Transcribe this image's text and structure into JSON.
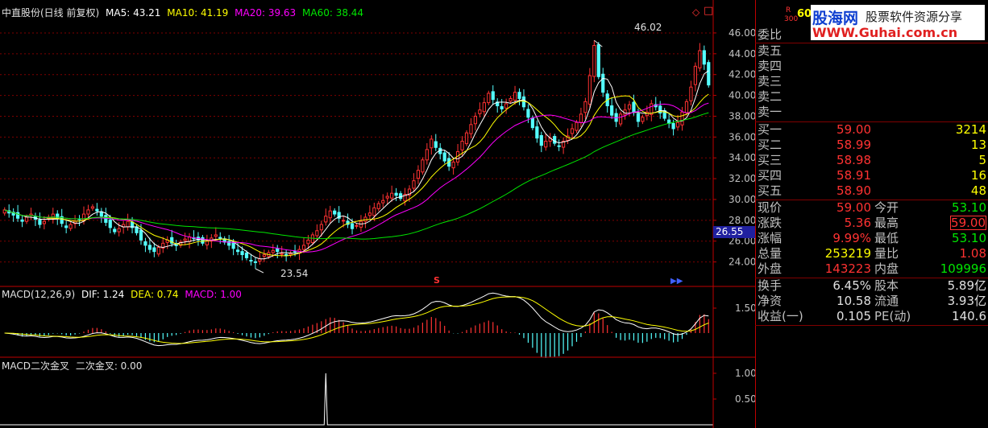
{
  "main_header": {
    "title": "中直股份(日线 前复权)",
    "ma5": "MA5: 43.21",
    "ma10": "MA10: 41.19",
    "ma20": "MA20: 39.63",
    "ma60": "MA60: 38.44"
  },
  "annotations": {
    "high_label": "46.02",
    "low_label": "23.54",
    "price_tag": "26.55",
    "marker_s": "S"
  },
  "macd_header": {
    "title": "MACD(12,26,9)",
    "dif": "DIF: 1.24",
    "dea": "DEA: 0.74",
    "macd": "MACD: 1.00"
  },
  "cross_header": {
    "title": "MACD二次金叉",
    "value": "二次金叉: 0.00"
  },
  "watermark": {
    "site_cn": "股海网",
    "slogan": "股票软件资源分享",
    "url": "WWW.Guhai.com.cn",
    "mini_r": "R",
    "mini_num": "300",
    "mini_code": "60"
  },
  "colors": {
    "up": "#ff3232",
    "down": "#54ffff",
    "ma5": "#ffffff",
    "ma10": "#ffff00",
    "ma20": "#ff00ff",
    "ma60": "#00e600",
    "grid": "#800000",
    "axis": "#c00000"
  },
  "order_book": {
    "ratio_label": "委比",
    "sells": [
      {
        "label": "卖五"
      },
      {
        "label": "卖四"
      },
      {
        "label": "卖三"
      },
      {
        "label": "卖二"
      },
      {
        "label": "卖一"
      }
    ],
    "buys": [
      {
        "label": "买一",
        "price": "59.00",
        "volume": "3214"
      },
      {
        "label": "买二",
        "price": "58.99",
        "volume": "13"
      },
      {
        "label": "买三",
        "price": "58.98",
        "volume": "5"
      },
      {
        "label": "买四",
        "price": "58.91",
        "volume": "16"
      },
      {
        "label": "买五",
        "price": "58.90",
        "volume": "48"
      }
    ]
  },
  "quote": {
    "rows": [
      {
        "l1": "现价",
        "v1": "59.00",
        "c1": "#ff3232",
        "l2": "今开",
        "v2": "53.10",
        "c2": "#00e600"
      },
      {
        "l1": "涨跌",
        "v1": "5.36",
        "c1": "#ff3232",
        "l2": "最高",
        "v2": "59.00",
        "c2": "#ff3232"
      },
      {
        "l1": "涨幅",
        "v1": "9.99%",
        "c1": "#ff3232",
        "l2": "最低",
        "v2": "53.10",
        "c2": "#00e600"
      },
      {
        "l1": "总量",
        "v1": "253219",
        "c1": "#ffff00",
        "l2": "量比",
        "v2": "1.08",
        "c2": "#ff3232"
      },
      {
        "l1": "外盘",
        "v1": "143223",
        "c1": "#ff3232",
        "l2": "内盘",
        "v2": "109996",
        "c2": "#00e600"
      }
    ],
    "rows2": [
      {
        "l1": "换手",
        "v1": "6.45%",
        "l2": "股本",
        "v2": "5.89亿"
      },
      {
        "l1": "净资",
        "v1": "10.58",
        "l2": "流通",
        "v2": "3.93亿"
      },
      {
        "l1": "收益(一)",
        "v1": "0.105",
        "l2": "PE(动)",
        "v2": "140.6"
      }
    ]
  },
  "chart_data": [
    {
      "type": "candlestick",
      "title": "中直股份(日线 前复权)",
      "ylim": [
        22.5,
        47
      ],
      "y_ticks": [
        "46.00",
        "44.00",
        "42.00",
        "40.00",
        "38.00",
        "36.00",
        "34.00",
        "32.00",
        "30.00",
        "28.00",
        "26.00",
        "24.00"
      ],
      "close_approx": [
        29.0,
        28.7,
        28.5,
        28.2,
        27.9,
        28.3,
        28.6,
        28.1,
        27.6,
        27.9,
        28.3,
        28.6,
        28.2,
        27.7,
        27.3,
        27.6,
        27.9,
        28.1,
        28.6,
        29.0,
        29.3,
        28.9,
        28.4,
        27.8,
        27.3,
        26.9,
        27.2,
        27.6,
        27.9,
        27.3,
        26.8,
        26.1,
        25.6,
        25.2,
        25.0,
        25.4,
        25.8,
        26.1,
        25.8,
        25.6,
        25.9,
        26.2,
        26.4,
        26.3,
        26.1,
        25.8,
        26.0,
        26.3,
        26.6,
        26.3,
        25.9,
        25.6,
        25.3,
        25.0,
        24.7,
        24.4,
        24.1,
        24.0,
        24.3,
        24.7,
        24.9,
        25.1,
        25.0,
        24.8,
        24.6,
        24.8,
        25.0,
        25.2,
        25.6,
        26.1,
        26.6,
        27.0,
        27.6,
        28.4,
        28.9,
        28.6,
        28.2,
        28.0,
        27.6,
        27.2,
        27.5,
        27.9,
        28.3,
        28.7,
        29.2,
        29.6,
        29.9,
        30.3,
        30.6,
        30.4,
        30.1,
        30.5,
        31.0,
        31.8,
        32.8,
        33.8,
        34.8,
        35.8,
        35.0,
        34.4,
        33.7,
        33.2,
        33.6,
        34.6,
        35.6,
        36.4,
        37.2,
        38.0,
        38.6,
        39.3,
        40.2,
        39.6,
        39.0,
        38.7,
        39.2,
        39.7,
        40.3,
        39.7,
        38.9,
        37.9,
        36.9,
        35.9,
        35.2,
        35.6,
        35.9,
        35.4,
        35.1,
        35.6,
        36.1,
        36.8,
        37.4,
        38.2,
        39.4,
        41.9,
        44.8,
        41.8,
        40.3,
        39.0,
        38.1,
        37.5,
        38.2,
        38.6,
        39.1,
        38.4,
        37.5,
        37.9,
        38.4,
        39.2,
        38.9,
        38.3,
        37.8,
        37.3,
        36.8,
        37.4,
        38.4,
        39.4,
        40.8,
        42.8,
        44.3,
        43.0,
        41.0
      ],
      "series": [
        {
          "name": "MA5",
          "last": 43.21
        },
        {
          "name": "MA10",
          "last": 41.19
        },
        {
          "name": "MA20",
          "last": 39.63
        },
        {
          "name": "MA60",
          "last": 38.44
        }
      ]
    },
    {
      "type": "bar",
      "title": "MACD(12,26,9)",
      "y_ticks": [
        "1.50"
      ],
      "dif_last": 1.24,
      "dea_last": 0.74,
      "macd_last": 1.0
    },
    {
      "type": "line",
      "title": "MACD二次金叉",
      "y_ticks": [
        "1.00",
        "0.50"
      ],
      "spike_x_index": 73
    }
  ]
}
